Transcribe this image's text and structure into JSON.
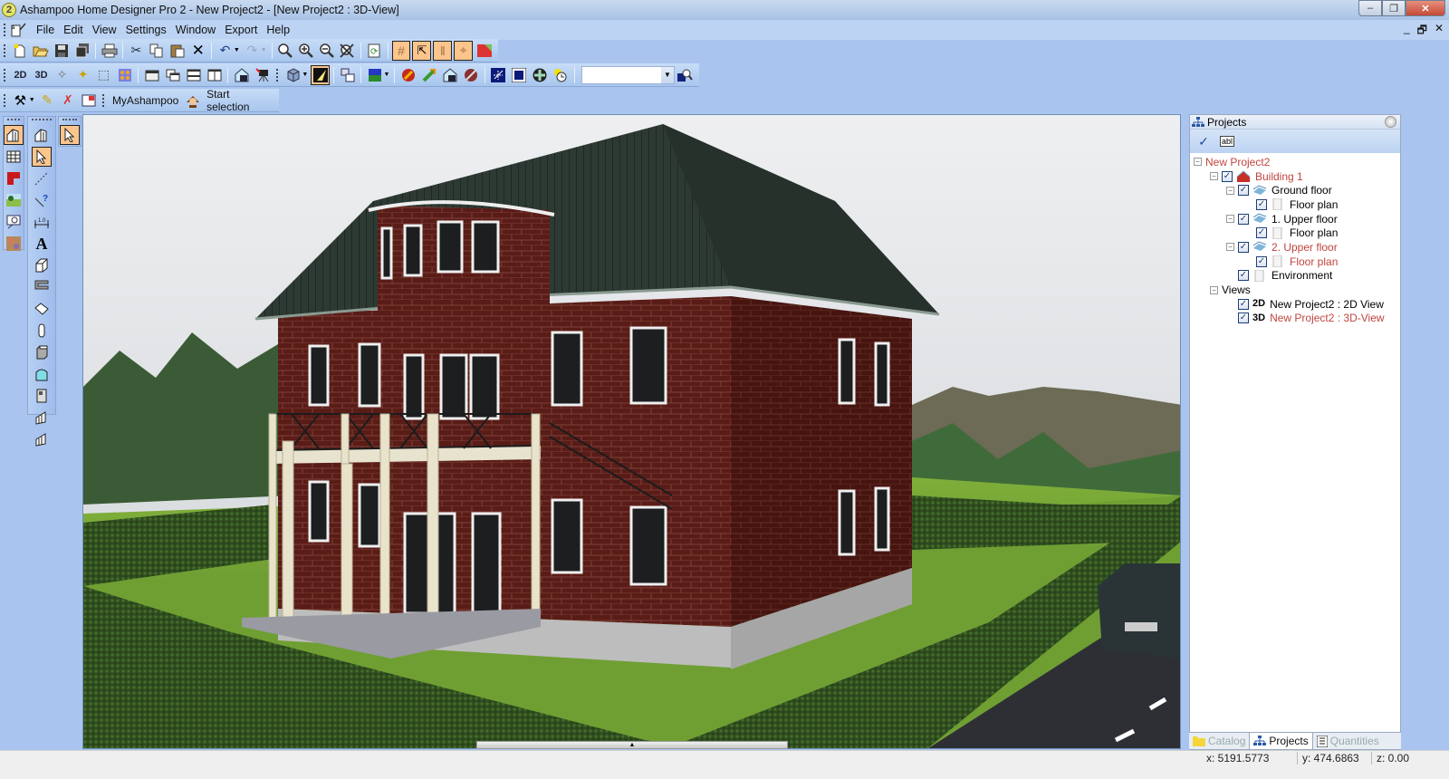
{
  "window": {
    "title": "Ashampoo Home Designer Pro 2 - New Project2 - [New Project2 : 3D-View]",
    "logo_glyph": "2",
    "controls": {
      "minimize": "–",
      "restore": "❐",
      "close": "✕"
    }
  },
  "menubar": {
    "items": [
      "File",
      "Edit",
      "View",
      "Settings",
      "Window",
      "Export",
      "Help"
    ],
    "mdi_controls": {
      "minimize": "_",
      "restore": "🗗",
      "close": "✕"
    }
  },
  "toolbar_standard": {
    "buttons": [
      {
        "name": "new-icon",
        "glyph": "🗋"
      },
      {
        "name": "open-icon",
        "glyph": "📂"
      },
      {
        "name": "save-icon",
        "glyph": "💾"
      },
      {
        "name": "save-all-icon",
        "glyph": "🗐"
      },
      {
        "name": "print-icon",
        "glyph": "🖶"
      },
      {
        "name": "cut-icon",
        "glyph": "✂"
      },
      {
        "name": "copy-icon",
        "glyph": "⎘"
      },
      {
        "name": "paste-icon",
        "glyph": "📋"
      },
      {
        "name": "delete-icon",
        "glyph": "✕"
      },
      {
        "name": "undo-icon",
        "glyph": "↶"
      },
      {
        "name": "redo-icon",
        "glyph": "↷"
      },
      {
        "name": "zoom-icon",
        "glyph": "🔍"
      },
      {
        "name": "zoom-in-icon",
        "glyph": "⊕"
      },
      {
        "name": "zoom-out-icon",
        "glyph": "⊖"
      },
      {
        "name": "zoom-fit-icon",
        "glyph": "⌧"
      },
      {
        "name": "refresh-icon",
        "glyph": "⟳"
      },
      {
        "name": "grid-icon",
        "glyph": "#"
      },
      {
        "name": "snap-cursor-icon",
        "glyph": "⇱"
      },
      {
        "name": "guides-icon",
        "glyph": "‖"
      },
      {
        "name": "snap-lines-icon",
        "glyph": "⌖"
      },
      {
        "name": "render-icon",
        "glyph": "◩"
      }
    ]
  },
  "toolbar_view": {
    "buttons": [
      {
        "name": "new-2d-view-icon",
        "glyph": "2D"
      },
      {
        "name": "new-3d-view-icon",
        "glyph": "3D"
      },
      {
        "name": "walkthrough-icon",
        "glyph": "✧"
      },
      {
        "name": "light-icon",
        "glyph": "✦"
      },
      {
        "name": "new-object-icon",
        "glyph": "⬚"
      },
      {
        "name": "texture-icon",
        "glyph": "▦"
      },
      {
        "name": "window-icon",
        "glyph": "▭"
      },
      {
        "name": "cascade-icon",
        "glyph": "⧉"
      },
      {
        "name": "tile-horizontal-icon",
        "glyph": "⊟"
      },
      {
        "name": "tile-vertical-icon",
        "glyph": "◫"
      },
      {
        "name": "save-view-icon",
        "glyph": "⌂"
      },
      {
        "name": "camera-icon",
        "glyph": "🎥"
      },
      {
        "name": "view-mode-icon",
        "glyph": "⬢"
      },
      {
        "name": "lighting-icon",
        "glyph": "◪"
      },
      {
        "name": "copy-view-icon",
        "glyph": "⧉"
      },
      {
        "name": "background-color-icon",
        "glyph": "■"
      },
      {
        "name": "sun-icon",
        "glyph": "●"
      },
      {
        "name": "move-icon",
        "glyph": "⤢"
      },
      {
        "name": "home-save-icon",
        "glyph": "⌂"
      },
      {
        "name": "edit-pen-icon",
        "glyph": "✎"
      },
      {
        "name": "axis-icon",
        "glyph": "✛"
      },
      {
        "name": "frame-axis-icon",
        "glyph": "⊡"
      },
      {
        "name": "navigation-icon",
        "glyph": "✜"
      },
      {
        "name": "sun-clock-icon",
        "glyph": "◔"
      },
      {
        "name": "find-icon",
        "glyph": "🔎"
      }
    ],
    "combo_value": ""
  },
  "toolbar_extras": {
    "link_label": "MyAshampoo",
    "start_selection_label": "Start selection"
  },
  "left_tools": {
    "group1": [
      "building-icon",
      "table-icon",
      "floor-plan-icon",
      "landscape-icon",
      "zoom-window-icon",
      "material-icon"
    ],
    "group2": [
      "wall-tool-icon",
      "select-arrow-icon",
      "line-icon",
      "measure-help-icon",
      "dimension-icon",
      "text-icon",
      "wall-icon",
      "stairs-icon",
      "slab-icon",
      "column-icon",
      "chimney-icon",
      "window-tool-icon",
      "door-icon",
      "railing-icon",
      "facade-icon"
    ],
    "dimension_label": "1.0",
    "text_label": "A"
  },
  "projects_panel": {
    "title": "Projects",
    "tools": {
      "check": "✓",
      "rename": "abl"
    },
    "tree": [
      {
        "label": "New Project2",
        "level": 0,
        "expand": "−",
        "checked": null,
        "icon": null,
        "highlight": true
      },
      {
        "label": "Building 1",
        "level": 1,
        "expand": "−",
        "checked": true,
        "icon": "house",
        "highlight": true
      },
      {
        "label": "Ground floor",
        "level": 2,
        "expand": "−",
        "checked": true,
        "icon": "floor",
        "highlight": false
      },
      {
        "label": "Floor plan",
        "level": 3,
        "expand": null,
        "checked": true,
        "icon": "page",
        "highlight": false
      },
      {
        "label": "1. Upper floor",
        "level": 2,
        "expand": "−",
        "checked": true,
        "icon": "floor",
        "highlight": false
      },
      {
        "label": "Floor plan",
        "level": 3,
        "expand": null,
        "checked": true,
        "icon": "page",
        "highlight": false
      },
      {
        "label": "2. Upper floor",
        "level": 2,
        "expand": "−",
        "checked": true,
        "icon": "floor",
        "highlight": true
      },
      {
        "label": "Floor plan",
        "level": 3,
        "expand": null,
        "checked": true,
        "icon": "page",
        "highlight": true
      },
      {
        "label": "Environment",
        "level": 2,
        "expand": null,
        "checked": true,
        "icon": "page",
        "highlight": false
      },
      {
        "label": "Views",
        "level": 1,
        "expand": "−",
        "checked": null,
        "icon": null,
        "highlight": false
      },
      {
        "label": "New Project2 : 2D View",
        "level": 2,
        "expand": null,
        "checked": true,
        "icon": "2D",
        "highlight": false
      },
      {
        "label": "New Project2 : 3D-View",
        "level": 2,
        "expand": null,
        "checked": true,
        "icon": "3D",
        "highlight": true
      }
    ],
    "tabs": [
      {
        "label": "Catalog",
        "active": false
      },
      {
        "label": "Projects",
        "active": true
      },
      {
        "label": "Quantities",
        "active": false
      }
    ]
  },
  "status": {
    "x": "x: 5191.5773",
    "y": "y: 474.6863",
    "z": "z: 0.00"
  },
  "colors": {
    "accent_active": "#fbc58c",
    "tree_highlight": "#c0453f",
    "chrome": "#a9c4ef"
  }
}
